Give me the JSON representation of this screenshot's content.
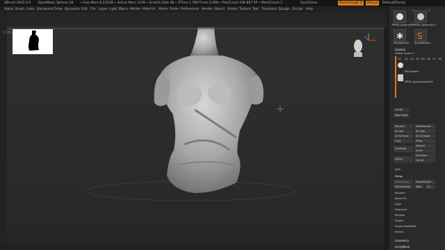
{
  "titlebar": {
    "app": "ZBrush 2022.0.5",
    "file": "DynaMesh_Sphere_64",
    "stats": "• Free Mem 8.232GB • Active Mem 1128 • Scratch Disk 48 • ZTime 1.769 Timer 0.006 • PolyCount 190.807 KP • MeshCount 1",
    "quicksave": "QuickSave",
    "see_through": "See-through 0",
    "menus_btn": "Menus",
    "default_script": "DefaultZScript"
  },
  "menubar": [
    "Alpha",
    "Brush",
    "Color",
    "Document",
    "Draw",
    "Dynamics",
    "Edit",
    "File",
    "Layer",
    "Light",
    "Macro",
    "Marker",
    "Material",
    "Movie",
    "Picker",
    "Preferences",
    "Render",
    "Stencil",
    "Stroke",
    "Texture",
    "Tool",
    "Transform",
    "Zplugin",
    "Zscript",
    "Help"
  ],
  "statusline": "1.741 4.415 0.375",
  "right": {
    "tools": [
      "PM3D_Sphere3D",
      "PM3D_Sphere3D_1",
      "PolyMesh3D",
      "SimpleBrush"
    ],
    "tool_count_a": "2",
    "tool_count_b": "2",
    "subtool_title": "Subtool",
    "visible_count": "Visible Count 4",
    "v_labels": [
      "V1",
      "V2",
      "V3",
      "V4",
      "V5",
      "V6",
      "V7",
      "V8"
    ],
    "subtools": [
      "PolySphere",
      "PM3D_Spheroinder3D1"
    ],
    "list_all": "List All",
    "new_folder": "New Folder",
    "btns": [
      [
        "Rename",
        "AutoReorder"
      ],
      [
        "All Low",
        "All High"
      ],
      [
        "All To Home",
        "All To Target"
      ],
      [
        "Copy",
        "Paste"
      ],
      [
        "Duplicate",
        "Append"
      ],
      [
        "",
        "Insert"
      ],
      [
        "Delete",
        "Del Other"
      ],
      [
        "",
        "Del All"
      ]
    ],
    "split": "Split",
    "merge": "Merge",
    "merge_btns": [
      [
        "MergeDown",
        "MergeSimilar"
      ],
      [
        "MergeVisible",
        "Weld",
        "Uv"
      ]
    ],
    "list": [
      "Boolean",
      "Bevel Pro",
      "Align",
      "Distribute",
      "Remesh",
      "Project",
      "Project BasRelief",
      "Extract"
    ],
    "geometry": "Geometry",
    "arraymesh": "ArrayMesh"
  }
}
